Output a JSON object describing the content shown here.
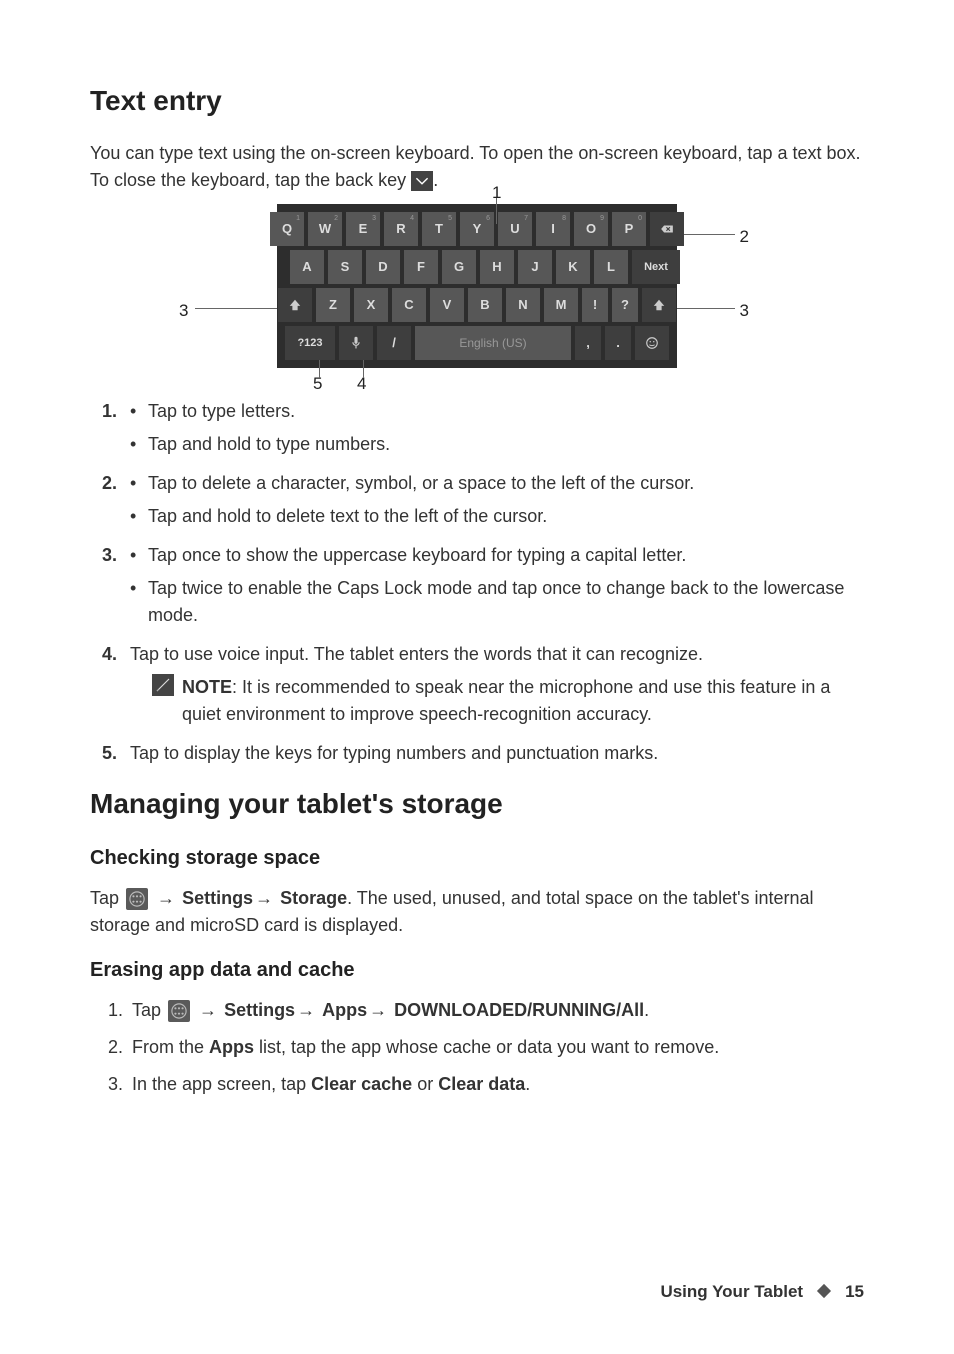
{
  "h_text_entry": "Text entry",
  "p_intro": "You can type text using the on-screen keyboard. To open the on-screen keyboard, tap a text box. To close the keyboard, tap the back key ",
  "kbd": {
    "row1": [
      {
        "label": "Q",
        "sup": "1"
      },
      {
        "label": "W",
        "sup": "2"
      },
      {
        "label": "E",
        "sup": "3"
      },
      {
        "label": "R",
        "sup": "4"
      },
      {
        "label": "T",
        "sup": "5"
      },
      {
        "label": "Y",
        "sup": "6"
      },
      {
        "label": "U",
        "sup": "7"
      },
      {
        "label": "I",
        "sup": "8"
      },
      {
        "label": "O",
        "sup": "9"
      },
      {
        "label": "P",
        "sup": "0"
      }
    ],
    "row2": [
      "A",
      "S",
      "D",
      "F",
      "G",
      "H",
      "J",
      "K",
      "L"
    ],
    "next": "Next",
    "row3": [
      "Z",
      "X",
      "C",
      "V",
      "B",
      "N",
      "M",
      "!",
      "?"
    ],
    "row4": {
      "sym": "?123",
      "space": "English (US)",
      "comma": ",",
      "dot": "."
    }
  },
  "callouts": {
    "c1": "1",
    "c2": "2",
    "c3l": "3",
    "c3r": "3",
    "c4": "4",
    "c5": "5"
  },
  "list": {
    "i1a": "Tap to type letters.",
    "i1b": "Tap and hold to type numbers.",
    "i2a": "Tap to delete a character, symbol, or a space to the left of the cursor.",
    "i2b": "Tap and hold to delete text to the left of the cursor.",
    "i3a": "Tap once to show the uppercase keyboard for typing a capital letter.",
    "i3b": "Tap twice to enable the Caps Lock mode and tap once to change back to the lowercase mode.",
    "i4": "Tap to use voice input. The tablet enters the words that it can recognize.",
    "note_bold": "NOTE",
    "note_rest": ": It is recommended to speak near the microphone and use this feature in a quiet environment to improve speech-recognition accuracy.",
    "i5": "Tap to display the keys for typing numbers and punctuation marks."
  },
  "nums": {
    "n1": "1.",
    "n2": "2.",
    "n3": "3.",
    "n4": "4.",
    "n5": "5."
  },
  "h_storage": "Managing your tablet's storage",
  "h_checking": "Checking storage space",
  "checking": {
    "tap": "Tap ",
    "settings": "Settings",
    "storage": "Storage",
    "rest": ". The used, unused, and total space on the tablet's internal storage and microSD card is displayed."
  },
  "h_erasing": "Erasing app data and cache",
  "erasing": {
    "s1_tap": "Tap ",
    "s1_apps": "Apps",
    "s1_tail": "DOWNLOADED/RUNNING/All",
    "s2_a": "From the ",
    "s2_apps": "Apps",
    "s2_b": " list, tap the app whose cache or data you want to remove.",
    "s3_a": "In the app screen, tap ",
    "s3_cc": "Clear cache",
    "s3_or": " or ",
    "s3_cd": "Clear data",
    "s3_dot": "."
  },
  "arrow": "→",
  "settings_word": "Settings",
  "footer": {
    "title": "Using Your Tablet",
    "page": "15"
  }
}
